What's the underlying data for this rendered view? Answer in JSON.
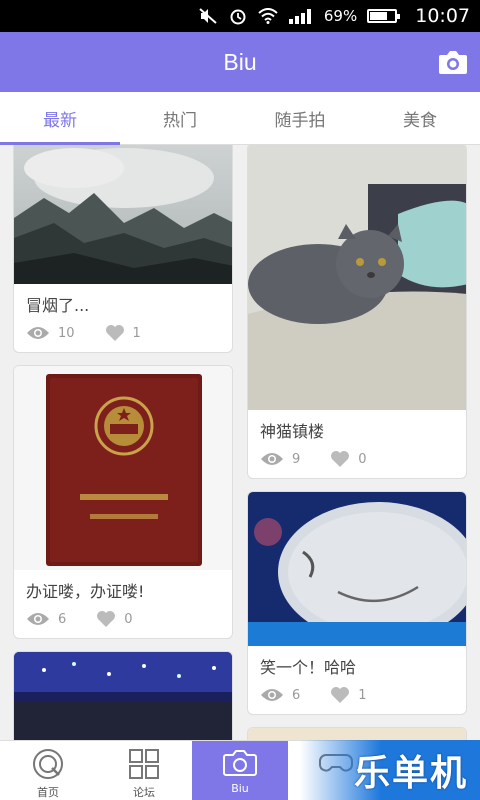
{
  "status_bar": {
    "battery": "69%",
    "time": "10:07",
    "battery_level": 0.69
  },
  "header": {
    "title": "Biu"
  },
  "tabs": [
    {
      "label": "最新"
    },
    {
      "label": "热门"
    },
    {
      "label": "随手拍"
    },
    {
      "label": "美食"
    }
  ],
  "feed": {
    "left": [
      {
        "title": "冒烟了...",
        "views": "10",
        "likes": "1"
      },
      {
        "title": "办证喽，办证喽!",
        "views": "6",
        "likes": "0"
      }
    ],
    "right": [
      {
        "title": "神猫镇楼",
        "views": "9",
        "likes": "0"
      },
      {
        "title": "笑一个！哈哈",
        "views": "6",
        "likes": "1"
      }
    ]
  },
  "bottom_nav": [
    {
      "label": "首页"
    },
    {
      "label": "论坛"
    },
    {
      "label": "Biu"
    },
    {
      "label": ""
    }
  ],
  "watermark": "乐单机",
  "colors": {
    "accent": "#7f76e8",
    "watermark_blue": "#1e78dc"
  }
}
